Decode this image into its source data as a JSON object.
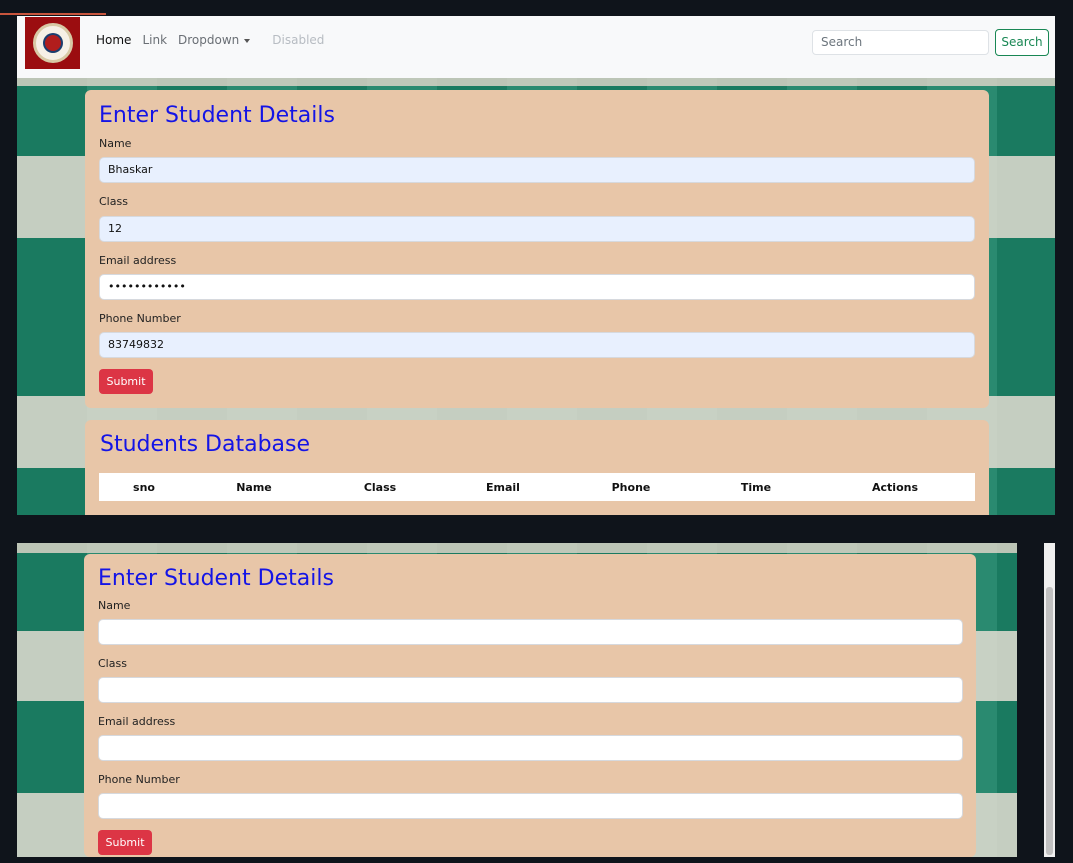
{
  "navbar": {
    "home": "Home",
    "link": "Link",
    "dropdown": "Dropdown",
    "disabled": "Disabled",
    "search_placeholder": "Search",
    "search_button": "Search"
  },
  "form_top": {
    "title": "Enter Student Details",
    "name_label": "Name",
    "name_value": "Bhaskar",
    "class_label": "Class",
    "class_value": "12",
    "email_label": "Email address",
    "email_value": "••••••••••••",
    "phone_label": "Phone Number",
    "phone_value": "83749832",
    "submit": "Submit"
  },
  "database": {
    "title": "Students Database",
    "columns": [
      "sno",
      "Name",
      "Class",
      "Email",
      "Phone",
      "Time",
      "Actions"
    ]
  },
  "side_badge": "›,‹",
  "form_bottom": {
    "title": "Enter Student Details",
    "name_label": "Name",
    "class_label": "Class",
    "email_label": "Email address",
    "phone_label": "Phone Number",
    "submit": "Submit"
  },
  "colors": {
    "card": "#e8c6a8",
    "title": "#1414e6",
    "submit": "#dc3545",
    "search_btn": "#198754"
  }
}
